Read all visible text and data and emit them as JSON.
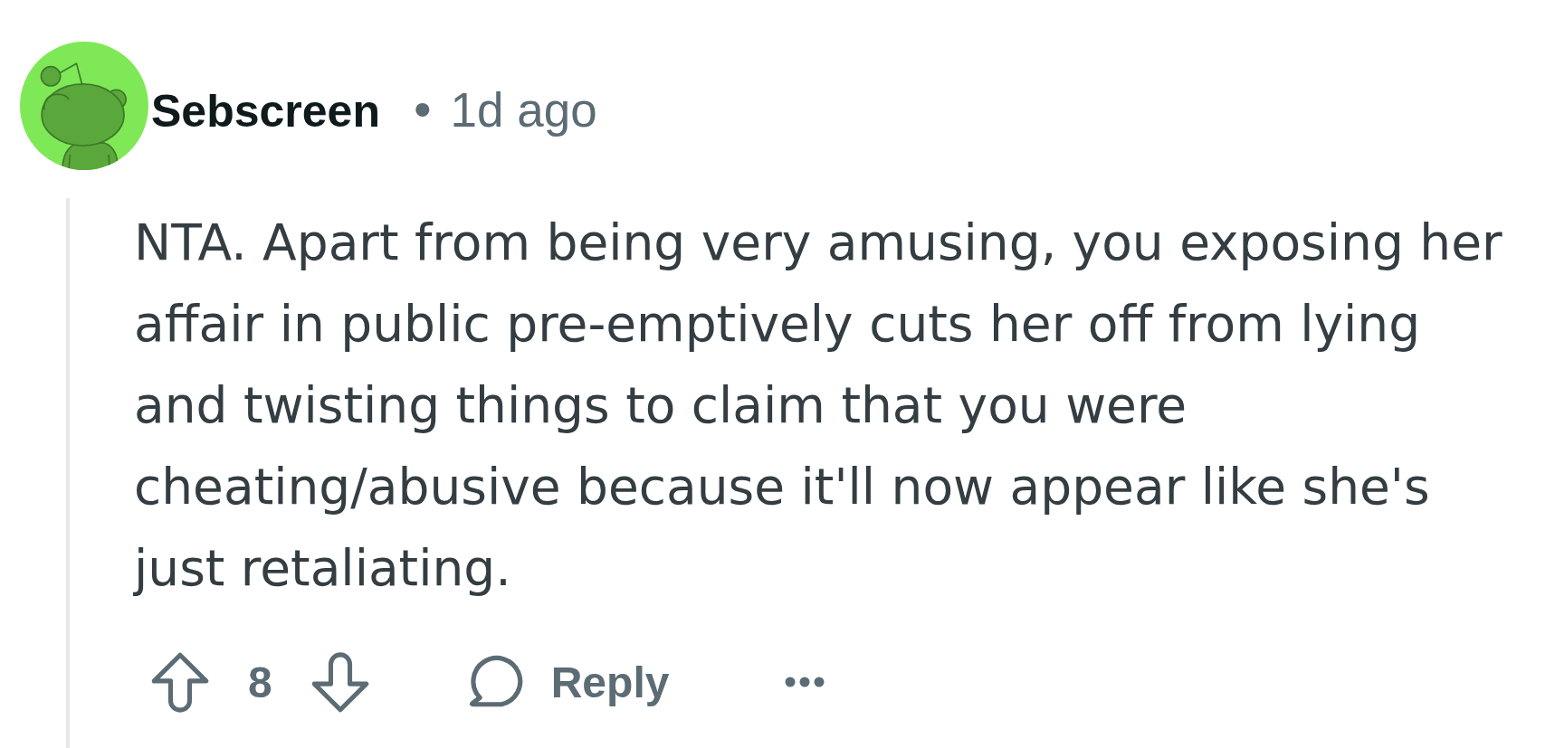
{
  "comment": {
    "author": "Sebscreen",
    "separator": "•",
    "time": "1d ago",
    "body": "NTA. Apart from being very amusing, you exposing her affair in public pre-emptively cuts her off from lying and twisting things to claim that you were cheating/abusive because it'll now appear like she's just retaliating.",
    "upvoted": false,
    "score": "8",
    "downvoted": false,
    "reply_label": "Reply"
  }
}
